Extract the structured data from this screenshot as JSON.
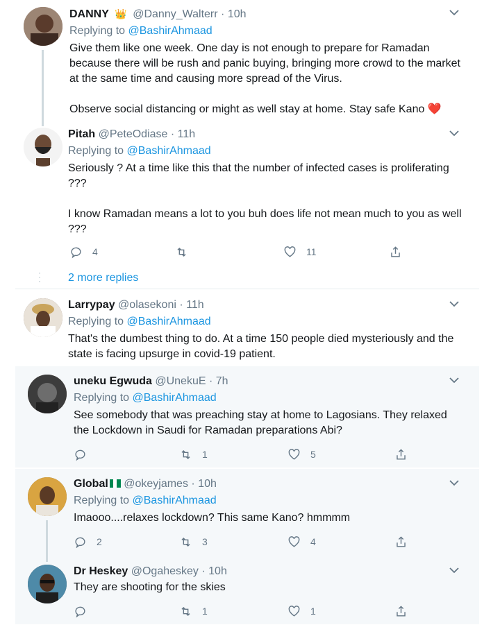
{
  "replying_label": "Replying to",
  "tweets": [
    {
      "name": "DANNY",
      "badge": "👑",
      "handle": "@Danny_Walterr",
      "time": "· 10h",
      "reply_to": "@BashirAhmaad",
      "text": "Give them like one week. One day is not enough to prepare for Ramadan because there will be rush and panic buying, bringing more crowd to the market at the same time and causing more spread of the Virus.\n\nObserve social distancing or might as well stay at home. Stay safe Kano ❤️"
    },
    {
      "name": "Pitah",
      "handle": "@PeteOdiase",
      "time": "· 11h",
      "reply_to": "@BashirAhmaad",
      "text": "Seriously ? At a time like this that the number of infected cases is proliferating ???\n\nI know Ramadan means a lot to you buh does life not mean much to you as well ???",
      "replies": "4",
      "retweets": "",
      "likes": "11"
    },
    {
      "name": "Larrypay",
      "handle": "@olasekoni",
      "time": "· 11h",
      "reply_to": "@BashirAhmaad",
      "text": "That's the dumbest thing to do. At a time 150 people died mysteriously and the state is facing upsurge in covid-19 patient."
    },
    {
      "name": "uneku Egwuda",
      "handle": "@UnekuE",
      "time": "· 7h",
      "reply_to": "@BashirAhmaad",
      "text": "See somebody that was preaching stay at home to Lagosians. They relaxed the Lockdown in Saudi for Ramadan preparations Abi?",
      "replies": "",
      "retweets": "1",
      "likes": "5"
    },
    {
      "name": "Global",
      "handle": "@okeyjames",
      "time": "· 10h",
      "reply_to": "@BashirAhmaad",
      "text": "Imaooo....relaxes lockdown? This same Kano? hmmmm",
      "replies": "2",
      "retweets": "3",
      "likes": "4"
    },
    {
      "name": "Dr Heskey",
      "handle": "@Ogaheskey",
      "time": "· 10h",
      "text": "They are shooting for the skies",
      "replies": "",
      "retweets": "1",
      "likes": "1"
    }
  ],
  "more_replies": "2 more replies",
  "colors": {
    "link": "#1b95e0",
    "secondary": "#657786",
    "flag_green": "#008751"
  },
  "icons": [
    "reply-icon",
    "retweet-icon",
    "like-icon",
    "share-icon",
    "chevron-down-icon",
    "crown-icon",
    "nigeria-flag-icon"
  ]
}
